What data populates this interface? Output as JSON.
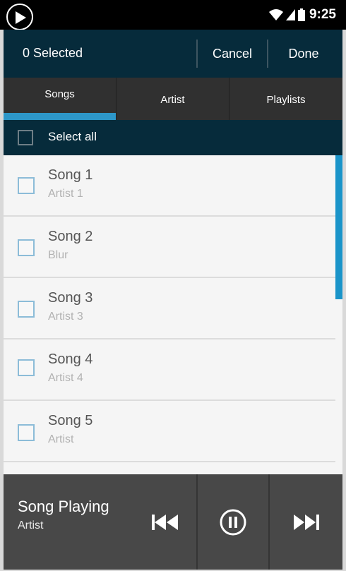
{
  "status_bar": {
    "time": "9:25",
    "icons": [
      "play-circle-icon",
      "wifi-icon",
      "signal-icon",
      "battery-icon"
    ]
  },
  "action_bar": {
    "selected_text": "0 Selected",
    "cancel_label": "Cancel",
    "done_label": "Done"
  },
  "tabs": [
    {
      "label": "Songs",
      "active": true
    },
    {
      "label": "Artist",
      "active": false
    },
    {
      "label": "Playlists",
      "active": false
    }
  ],
  "select_all": {
    "label": "Select all",
    "checked": false
  },
  "songs": [
    {
      "title": "Song 1",
      "artist": "Artist 1",
      "checked": false
    },
    {
      "title": "Song 2",
      "artist": "Blur",
      "checked": false
    },
    {
      "title": "Song 3",
      "artist": "Artist 3",
      "checked": false
    },
    {
      "title": "Song 4",
      "artist": "Artist 4",
      "checked": false
    },
    {
      "title": "Song 5",
      "artist": "Artist",
      "checked": false
    }
  ],
  "player": {
    "title": "Song Playing",
    "artist": "Artist",
    "controls": [
      "previous-icon",
      "pause-icon",
      "next-icon"
    ]
  },
  "colors": {
    "header_bg": "#062b3b",
    "tab_bg": "#303030",
    "accent": "#2d97c9",
    "player_bg": "#484848",
    "list_bg": "#f5f5f5"
  }
}
